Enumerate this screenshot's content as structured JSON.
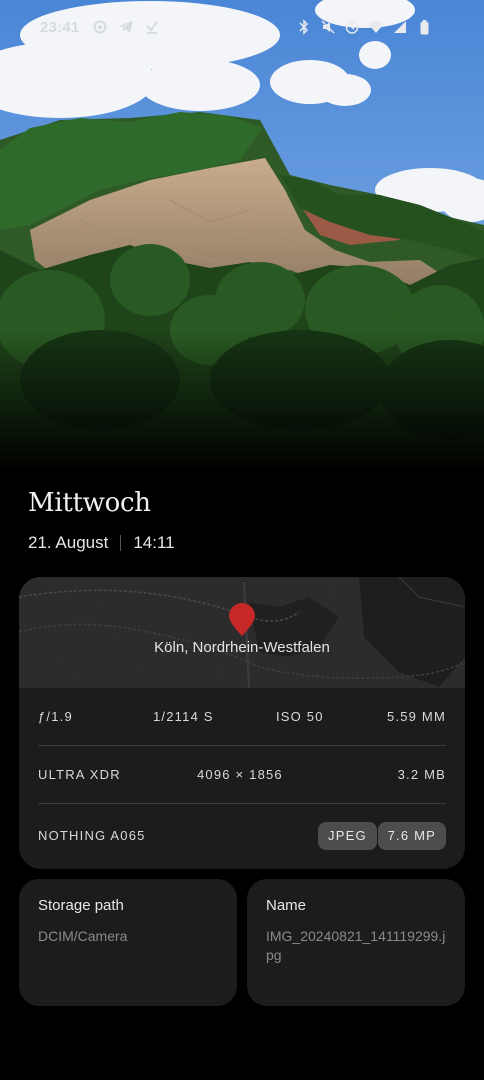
{
  "status_bar": {
    "time": "23:41",
    "left_icons": [
      "sync-icon",
      "telegram-icon",
      "download-done-icon"
    ],
    "right_icons": [
      "bluetooth-icon",
      "mute-icon",
      "alarm-icon",
      "wifi-icon",
      "signal-icon",
      "battery-icon"
    ]
  },
  "photo": {
    "subject": "quarry-cliff-landscape"
  },
  "header": {
    "weekday": "Mittwoch",
    "date": "21. August",
    "time": "14:11"
  },
  "location": {
    "label": "Köln, Nordrhein-Westfalen",
    "pin_color": "#c62828"
  },
  "exif": {
    "aperture": "ƒ/1.9",
    "shutter": "1/2114 S",
    "iso": "ISO 50",
    "focal_length": "5.59 MM",
    "mode": "ULTRA XDR",
    "resolution": "4096 × 1856",
    "file_size": "3.2 MB",
    "device": "NOTHING A065",
    "format": "JPEG",
    "megapixels": "7.6 MP"
  },
  "storage": {
    "title": "Storage path",
    "value": "DCIM/Camera"
  },
  "name": {
    "title": "Name",
    "value": "IMG_20240821_141119299.jpg"
  }
}
